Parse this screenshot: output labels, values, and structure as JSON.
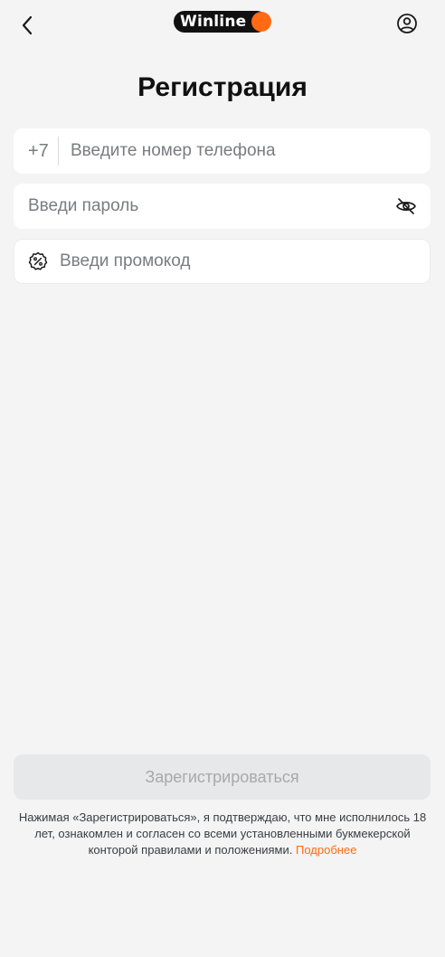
{
  "header": {
    "logo_text": "Winline",
    "back_icon": "chevron-left-icon",
    "profile_icon": "user-circle-icon"
  },
  "page": {
    "title": "Регистрация"
  },
  "form": {
    "phone_prefix": "+7",
    "phone_placeholder": "Введите номер телефона",
    "phone_value": "",
    "password_placeholder": "Введи пароль",
    "password_value": "",
    "password_toggle_icon": "eye-off-icon",
    "promo_placeholder": "Введи промокод",
    "promo_value": "",
    "promo_icon": "percent-badge-icon"
  },
  "actions": {
    "register_label": "Зарегистрироваться"
  },
  "legal": {
    "text": "Нажимая «Зарегистрироваться», я подтверждаю, что мне исполнилось 18 лет, ознакомлен и согласен со всеми установленными букмекерской конторой правилами и положениями.",
    "link_label": "Подробнее"
  },
  "colors": {
    "background": "#f4f4f4",
    "accent": "#ff6a13",
    "logo_bg": "#111111",
    "disabled_button_bg": "#e7e8ea",
    "disabled_button_text": "#a7a9ad",
    "placeholder": "#7a7c80"
  }
}
